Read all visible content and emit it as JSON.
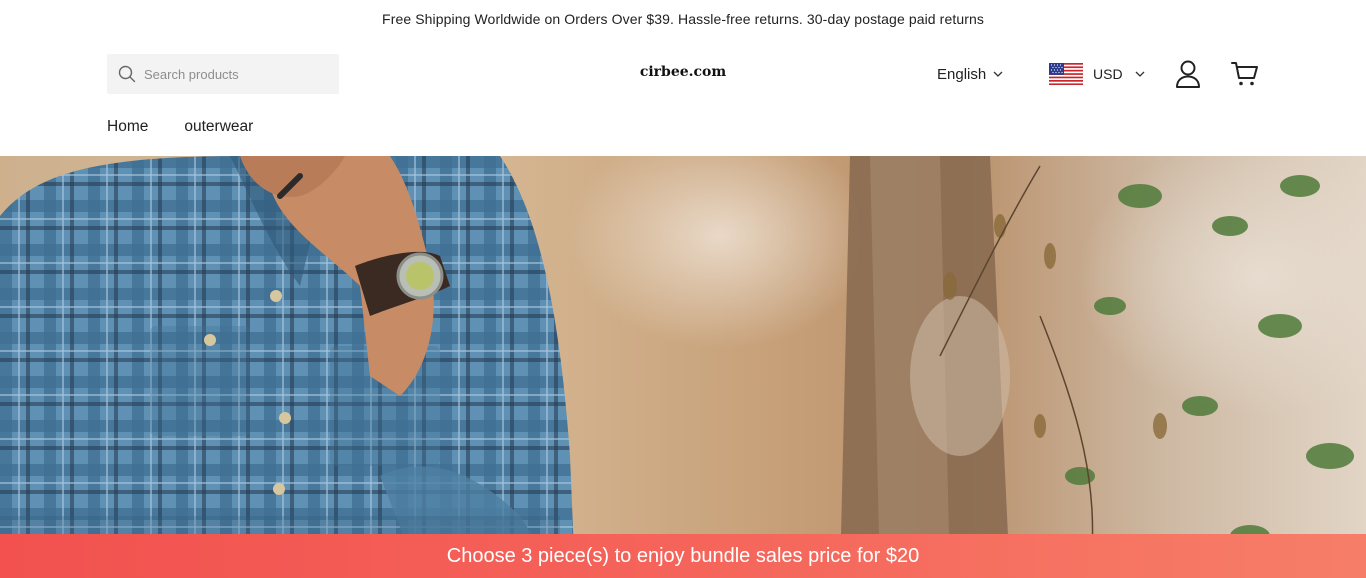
{
  "announcement": {
    "text": "Free Shipping Worldwide on Orders Over $39. Hassle-free returns. 30-day postage paid returns"
  },
  "header": {
    "search": {
      "placeholder": "Search products",
      "value": "",
      "icon": "search-icon"
    },
    "logo": "cirbee.com",
    "language": {
      "selected": "English",
      "icon": "chevron-down-icon"
    },
    "currency": {
      "selected": "USD",
      "flag": "us-flag-icon",
      "icon": "chevron-down-icon"
    },
    "account_icon": "user-icon",
    "cart_icon": "cart-icon"
  },
  "nav": {
    "items": [
      {
        "label": "Home"
      },
      {
        "label": "outerwear"
      }
    ]
  },
  "hero": {
    "image": "man-in-plaid-shirt-with-watch-outdoors"
  },
  "bundle_banner": {
    "text": "Choose 3 piece(s) to enjoy bundle sales price for $20"
  },
  "colors": {
    "banner_start": "#f2514f",
    "banner_end": "#f67e68",
    "search_bg": "#f3f3f3",
    "text": "#222222"
  }
}
